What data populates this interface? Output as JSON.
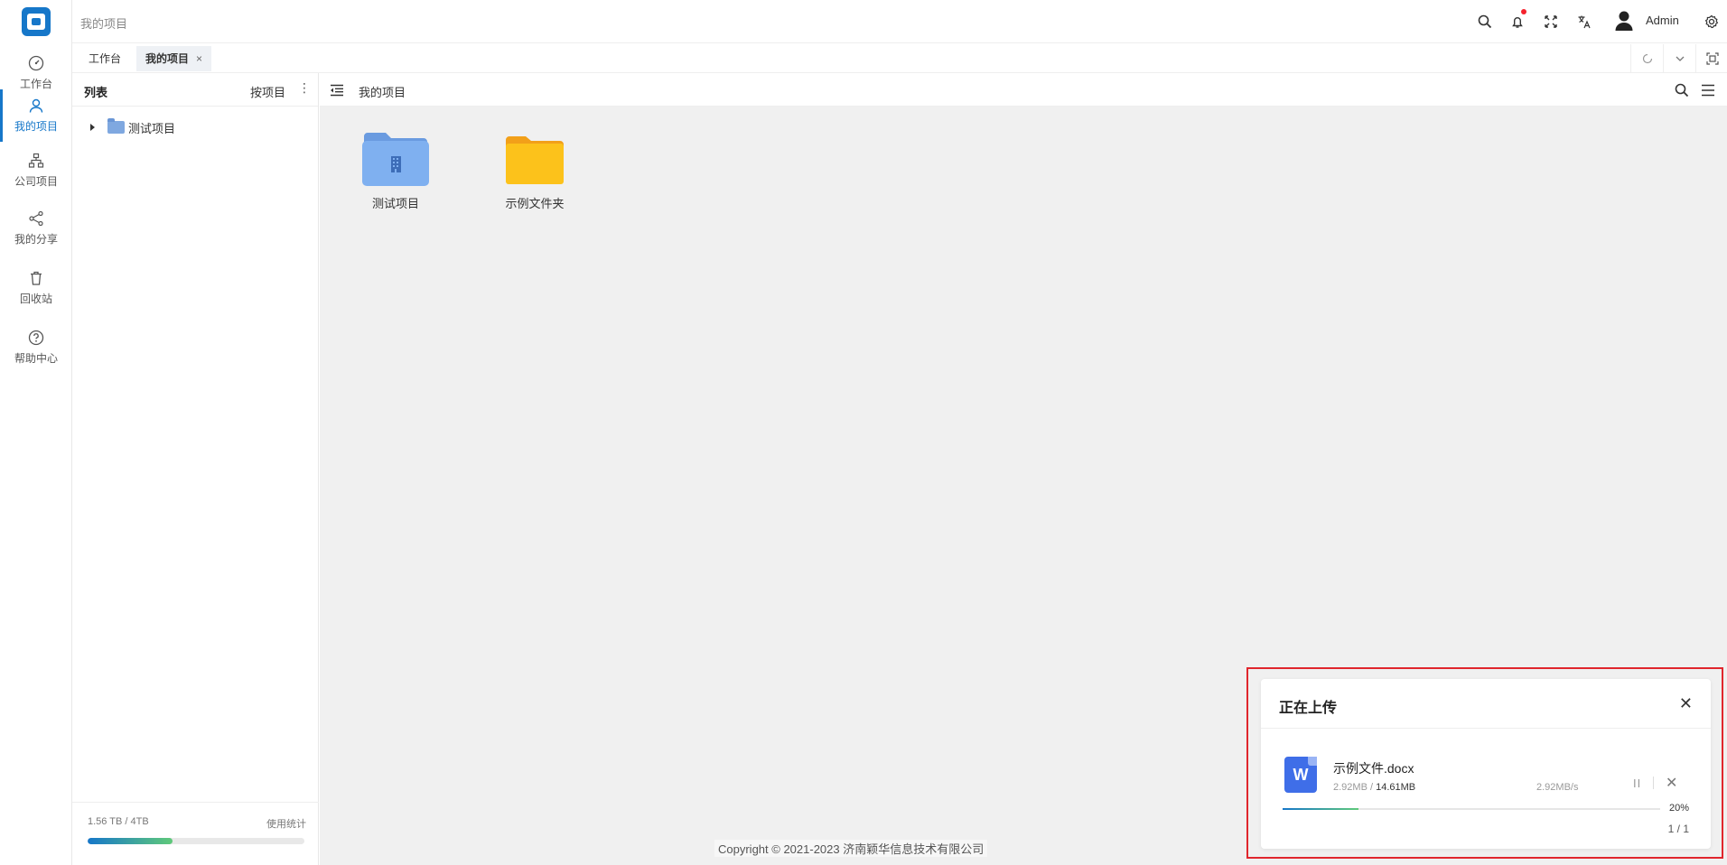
{
  "header": {
    "breadcrumb": "我的项目",
    "user_name": "Admin",
    "icons": [
      "search-icon",
      "bell-icon",
      "fullscreen-icon",
      "translate-icon",
      "avatar",
      "gear-icon"
    ]
  },
  "sidebar": {
    "items": [
      {
        "label": "工作台",
        "icon": "dashboard-icon"
      },
      {
        "label": "我的项目",
        "icon": "user-icon",
        "active": true
      },
      {
        "label": "公司项目",
        "icon": "org-icon"
      },
      {
        "label": "我的分享",
        "icon": "share-icon"
      },
      {
        "label": "回收站",
        "icon": "trash-icon"
      },
      {
        "label": "帮助中心",
        "icon": "help-icon"
      }
    ]
  },
  "tabs": [
    {
      "label": "工作台"
    },
    {
      "label": "我的项目",
      "active": true,
      "closable": true,
      "close": "×"
    }
  ],
  "left_panel": {
    "title": "列表",
    "sort_label": "按项目",
    "more": "⋮",
    "tree": [
      {
        "label": "测试项目"
      }
    ],
    "storage_text": "1.56 TB / 4TB",
    "storage_fraction": 0.39,
    "stats_label": "使用统计"
  },
  "main": {
    "title": "我的项目",
    "items": [
      {
        "label": "测试项目",
        "type": "project-folder",
        "color": "#7fb0f0"
      },
      {
        "label": "示例文件夹",
        "type": "folder",
        "color": "#fcc21b"
      }
    ],
    "footer": "Copyright © 2021-2023 济南颖华信息技术有限公司"
  },
  "upload": {
    "title": "正在上传",
    "close": "✕",
    "file": {
      "name": "示例文件.docx",
      "icon_letter": "W",
      "uploaded": "2.92MB",
      "sep": " / ",
      "total": "14.61MB",
      "speed": "2.92MB/s",
      "progress_percent": "20%",
      "progress_fraction": 0.2,
      "pause": "II",
      "cancel": "✕"
    },
    "count": "1 / 1"
  },
  "colors": {
    "accent": "#1677c9",
    "highlight": "#e0262d"
  }
}
